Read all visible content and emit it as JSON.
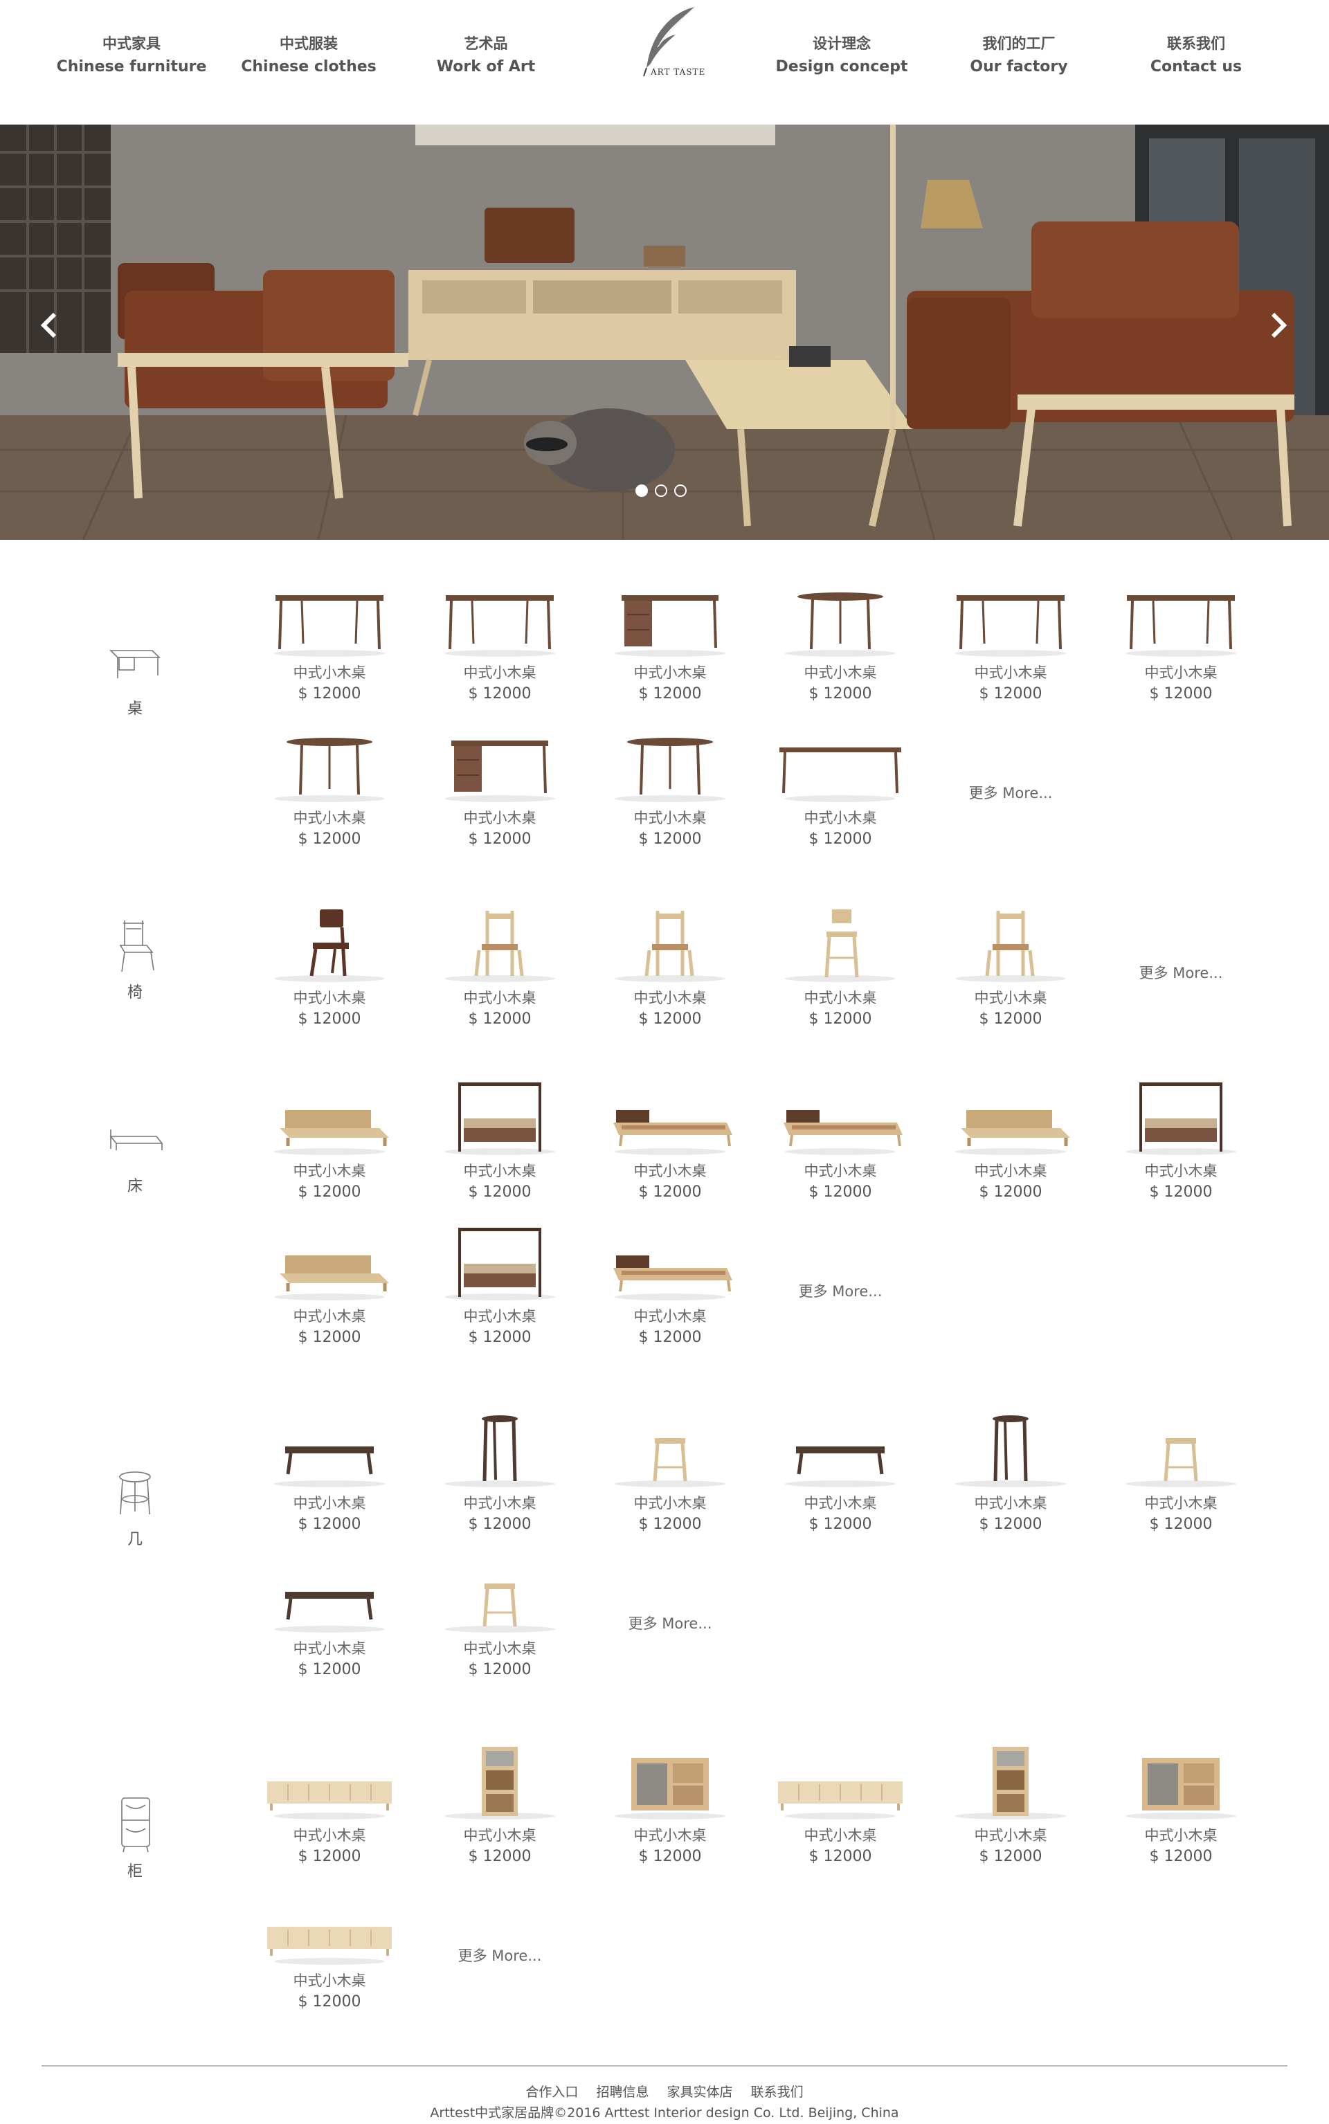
{
  "nav": {
    "items": [
      {
        "zh": "中式家具",
        "en": "Chinese furniture"
      },
      {
        "zh": "中式服装",
        "en": "Chinese clothes"
      },
      {
        "zh": "艺术品",
        "en": "Work of Art"
      },
      {
        "zh": "设计理念",
        "en": "Design concept"
      },
      {
        "zh": "我们的工厂",
        "en": "Our factory"
      },
      {
        "zh": "联系我们",
        "en": "Contact us"
      }
    ],
    "logo_text": "ART TASTE",
    "logo_icon": "feather-quill-icon"
  },
  "hero": {
    "slide_count": 3,
    "active_slide": 1,
    "prev_icon": "chevron-left-icon",
    "next_icon": "chevron-right-icon",
    "colors": {
      "wall": "#8d8a86",
      "floor": "#6b5a4b",
      "sofa": "#7a3f25",
      "wood": "#e2cfa8"
    }
  },
  "catalog": {
    "product_name": "中式小木桌",
    "product_price": "$ 12000",
    "more_label": "更多 More...",
    "categories": [
      {
        "label": "桌",
        "icon": "table-sketch-icon",
        "items": [
          "table",
          "table",
          "desk",
          "round-table",
          "table",
          "table",
          "round-table",
          "desk",
          "round-table",
          "long-table"
        ]
      },
      {
        "label": "椅",
        "icon": "chair-sketch-icon",
        "items": [
          "dark-chair",
          "light-chair",
          "light-chair",
          "bar-stool",
          "light-chair"
        ]
      },
      {
        "label": "床",
        "icon": "bed-sketch-icon",
        "items": [
          "platform-bed",
          "canopy-bed",
          "daybed",
          "daybed",
          "platform-bed",
          "canopy-bed",
          "platform-bed",
          "canopy-bed",
          "daybed"
        ]
      },
      {
        "label": "几",
        "icon": "stool-sketch-icon",
        "items": [
          "coffee-table",
          "tall-side-table",
          "stool",
          "coffee-table",
          "tall-side-table",
          "stool",
          "coffee-table",
          "stool"
        ]
      },
      {
        "label": "柜",
        "icon": "cabinet-sketch-icon",
        "items": [
          "tv-cabinet",
          "bookshelf",
          "sideboard",
          "tv-cabinet",
          "bookshelf",
          "sideboard",
          "tv-cabinet"
        ]
      }
    ]
  },
  "footer": {
    "links": [
      "合作入口",
      "招聘信息",
      "家具实体店",
      "联系我们"
    ],
    "copyright": "Arttest中式家居品牌©2016 Arttest Interior design Co. Ltd. Beijing, China"
  }
}
